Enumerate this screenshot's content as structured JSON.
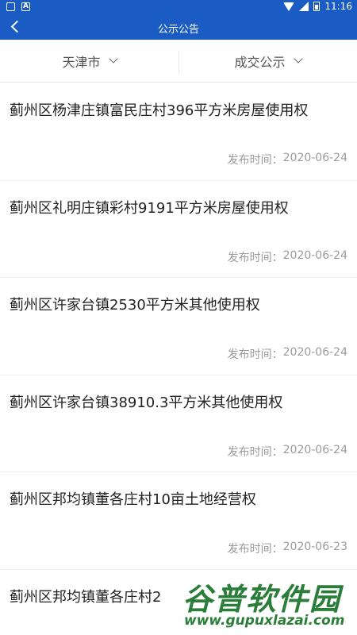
{
  "status_bar": {
    "time": "11:16",
    "left_icons": [
      "image-icon",
      "a-icon"
    ],
    "right_icons": [
      "wifi-icon",
      "signal-icon",
      "battery-icon"
    ]
  },
  "header": {
    "title": "公示公告",
    "back_icon": "back-arrow-icon"
  },
  "filters": [
    {
      "label": "天津市",
      "icon": "chevron-down-icon"
    },
    {
      "label": "成交公示",
      "icon": "chevron-down-icon"
    }
  ],
  "date_label": "发布时间：",
  "items": [
    {
      "title": "蓟州区杨津庄镇富民庄村396平方米房屋使用权",
      "date": "2020-06-24"
    },
    {
      "title": "蓟州区礼明庄镇彩村9191平方米房屋使用权",
      "date": "2020-06-24"
    },
    {
      "title": "蓟州区许家台镇2530平方米其他使用权",
      "date": "2020-06-24"
    },
    {
      "title": "蓟州区许家台镇38910.3平方米其他使用权",
      "date": "2020-06-24"
    },
    {
      "title": "蓟州区邦均镇董各庄村10亩土地经营权",
      "date": "2020-06-23"
    },
    {
      "title": "蓟州区邦均镇董各庄村2",
      "date": ""
    }
  ],
  "watermark": {
    "top": "谷普软件园",
    "bottom": "www.gupuxlazai.com"
  }
}
